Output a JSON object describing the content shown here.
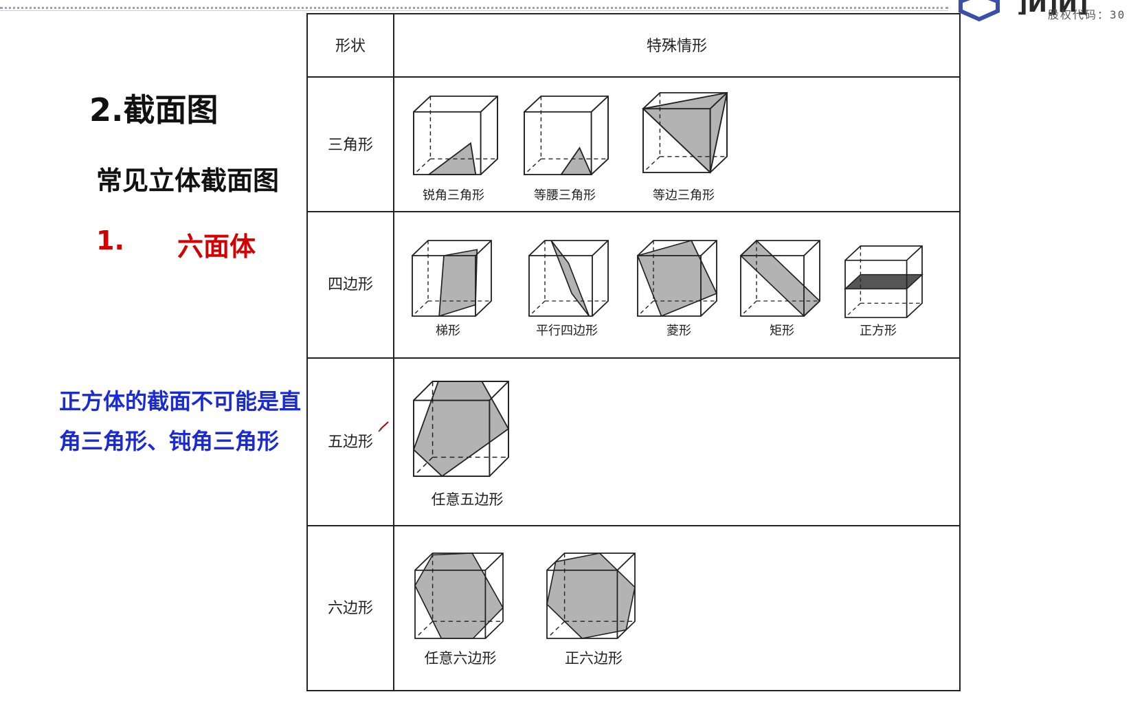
{
  "header": {
    "logo_text": "]Й]Й]",
    "stock_code_label": "股权代码：30"
  },
  "left": {
    "section_title": "2.截面图",
    "subtitle": "常见立体截面图",
    "item_number": "1.",
    "item_label": "六面体",
    "note": "正方体的截面不可能是直角三角形、钝角三角形"
  },
  "table": {
    "col_shape_header": "形状",
    "col_special_header": "特殊情形",
    "rows": [
      {
        "shape": "三角形",
        "cases": [
          "锐角三角形",
          "等腰三角形",
          "等边三角形"
        ]
      },
      {
        "shape": "四边形",
        "cases": [
          "梯形",
          "平行四边形",
          "菱形",
          "矩形",
          "正方形"
        ]
      },
      {
        "shape": "五边形",
        "cases": [
          "任意五边形"
        ]
      },
      {
        "shape": "六边形",
        "cases": [
          "任意六边形",
          "正六边形"
        ]
      }
    ]
  },
  "colors": {
    "note_blue": "#1a2bd6",
    "accent_red": "#d40000",
    "section_fill": "#b3b3b3",
    "line": "#222222"
  }
}
